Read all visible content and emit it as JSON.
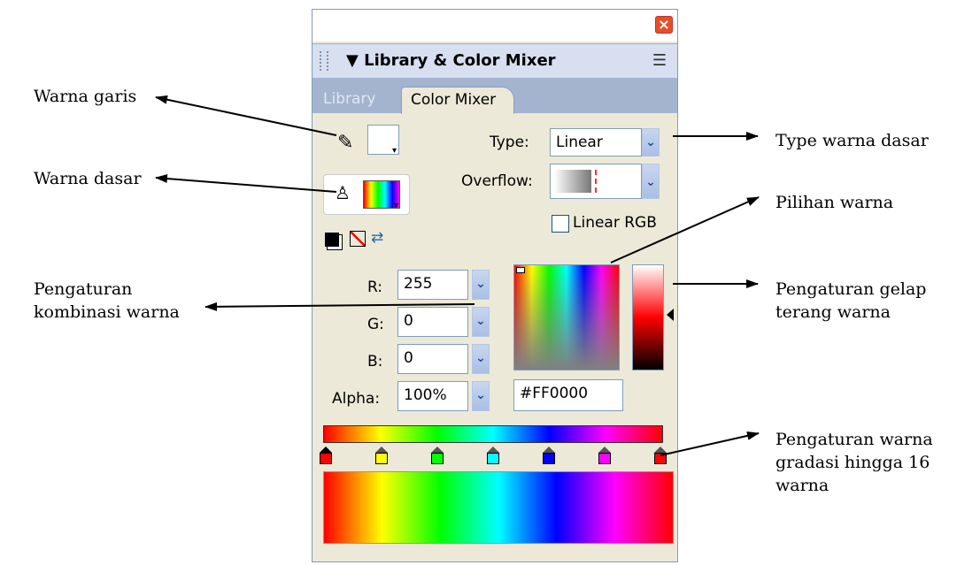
{
  "panel": {
    "close_icon": "close-icon",
    "title": "▼ Library & Color Mixer",
    "tabs": [
      "Library",
      "Color Mixer"
    ]
  },
  "mixer": {
    "type_label": "Type:",
    "type_value": "Linear",
    "overflow_label": "Overflow:",
    "linear_rgb_label": "Linear RGB",
    "r_label": "R:",
    "r_value": "255",
    "g_label": "G:",
    "g_value": "0",
    "b_label": "B:",
    "b_value": "0",
    "alpha_label": "Alpha:",
    "alpha_value": "100%",
    "hex_value": "#FF0000",
    "gradient_stop_colors": [
      "#ff0000",
      "#ffff00",
      "#00ff00",
      "#00ffff",
      "#0000ff",
      "#ff00ff",
      "#ff0000"
    ]
  },
  "annotations": {
    "warna_garis": "Warna garis",
    "warna_dasar": "Warna dasar",
    "pengaturan_kombinasi_1": "Pengaturan",
    "pengaturan_kombinasi_2": "kombinasi warna",
    "type_warna": "Type warna dasar",
    "pilihan_warna": "Pilihan warna",
    "gelap_terang_1": "Pengaturan  gelap",
    "gelap_terang_2": "terang warna",
    "gradasi_1": "Pengaturan  warna",
    "gradasi_2": "gradasi hingga 16",
    "gradasi_3": "warna"
  }
}
